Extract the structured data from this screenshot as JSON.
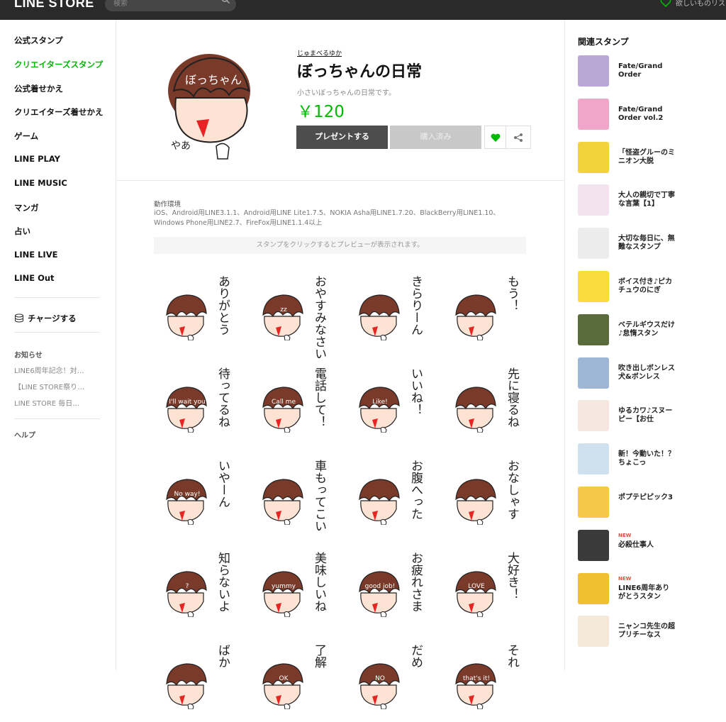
{
  "header": {
    "logo_line": "LINE",
    "logo_store": "STORE",
    "search_placeholder": "検索",
    "wishlist": "欲しいものリスト"
  },
  "leftnav": {
    "items": [
      {
        "label": "公式スタンプ",
        "active": false
      },
      {
        "label": "クリエイターズスタンプ",
        "active": true
      },
      {
        "label": "公式着せかえ",
        "active": false
      },
      {
        "label": "クリエイターズ着せかえ",
        "active": false
      },
      {
        "label": "ゲーム",
        "active": false
      },
      {
        "label": "LINE PLAY",
        "active": false
      },
      {
        "label": "LINE MUSIC",
        "active": false
      },
      {
        "label": "マンガ",
        "active": false
      },
      {
        "label": "占い",
        "active": false
      },
      {
        "label": "LINE LIVE",
        "active": false
      },
      {
        "label": "LINE Out",
        "active": false
      }
    ],
    "charge": "チャージする",
    "news_heading": "お知らせ",
    "news": [
      "LINE6周年記念！対…",
      "【LINE STORE祭り…",
      "LINE STORE 毎日…"
    ],
    "help": "ヘルプ"
  },
  "product": {
    "author": "じゅまべるゆか",
    "title": "ぼっちゃんの日常",
    "description": "小さいぼっちゃんの日常です。",
    "price": "￥120",
    "gift_button": "プレゼントする",
    "purchased_button": "購入済み",
    "hero_hair_text": "ぼっちゃん",
    "hero_say": "やあ"
  },
  "environment": {
    "label": "動作環境",
    "text": "iOS、Android用LINE3.1.1、Android用LINE Lite1.7.5、NOKIA Asha用LINE1.7.20、BlackBerry用LINE1.10、Windows Phone用LINE2.7、FireFox用LINE1.1.4以上"
  },
  "preview_hint": "スタンプをクリックするとプレビューが表示されます。",
  "stickers": [
    {
      "text": "ありがとう",
      "hair": ""
    },
    {
      "text": "おやすみなさい",
      "hair": "zz"
    },
    {
      "text": "きらりーん",
      "hair": ""
    },
    {
      "text": "もう！",
      "hair": ""
    },
    {
      "text": "待ってるね",
      "hair": "I'll wait you"
    },
    {
      "text": "電話して！",
      "hair": "Call me"
    },
    {
      "text": "いいね！",
      "hair": "Like!"
    },
    {
      "text": "先に寝るね",
      "hair": ""
    },
    {
      "text": "いやーん",
      "hair": "No way!"
    },
    {
      "text": "車もってこい",
      "hair": ""
    },
    {
      "text": "お腹へった",
      "hair": ""
    },
    {
      "text": "おなしゃす",
      "hair": ""
    },
    {
      "text": "知らないよ",
      "hair": "?"
    },
    {
      "text": "美味しいね",
      "hair": "yummy"
    },
    {
      "text": "お疲れさま",
      "hair": "good job!"
    },
    {
      "text": "大好き！",
      "hair": "LOVE"
    },
    {
      "text": "ばか",
      "hair": ""
    },
    {
      "text": "了解",
      "hair": "OK"
    },
    {
      "text": "だめ",
      "hair": "NO"
    },
    {
      "text": "それ",
      "hair": "that's it!"
    }
  ],
  "related": {
    "heading": "関連スタンプ",
    "items": [
      {
        "name": "Fate/Grand Order",
        "new": false,
        "color": "#b9a7d6"
      },
      {
        "name": "Fate/Grand Order vol.2",
        "new": false,
        "color": "#f0a6c8"
      },
      {
        "name": "「怪盗グルーのミニオン大脱",
        "new": false,
        "color": "#f2d33c"
      },
      {
        "name": "大人の親切で丁寧な言葉【1】",
        "new": false,
        "color": "#f3e3ef"
      },
      {
        "name": "大切な毎日に、無難なスタンプ",
        "new": false,
        "color": "#ececec"
      },
      {
        "name": "ボイス付き♪ピカチュウのにぎ",
        "new": false,
        "color": "#f7dc3c"
      },
      {
        "name": "ベテルギウスだけ♪怠惰スタン",
        "new": false,
        "color": "#5a6b3c"
      },
      {
        "name": "吹き出しボンレス犬&ボンレス",
        "new": false,
        "color": "#9fb7d4"
      },
      {
        "name": "ゆるカワ♪スヌーピー【お仕",
        "new": false,
        "color": "#f5e6e0"
      },
      {
        "name": "新！今動いた！？ちょこっ",
        "new": false,
        "color": "#cfe0ef"
      },
      {
        "name": "ポプテピピック3",
        "new": false,
        "color": "#f5c84a"
      },
      {
        "name": "必殺仕事人",
        "new": true,
        "color": "#3a3a3a"
      },
      {
        "name": "LINE6周年ありがとうスタン",
        "new": true,
        "color": "#f0c030"
      },
      {
        "name": "ニャンコ先生の超プリチーなス",
        "new": false,
        "color": "#f4e9d8"
      }
    ],
    "new_label": "NEW"
  },
  "colors": {
    "accent": "#00b900",
    "hair": "#7a3a2a",
    "skin": "#fde3d4",
    "mouth": "#e82323",
    "topbar": "#2a2a2a"
  }
}
